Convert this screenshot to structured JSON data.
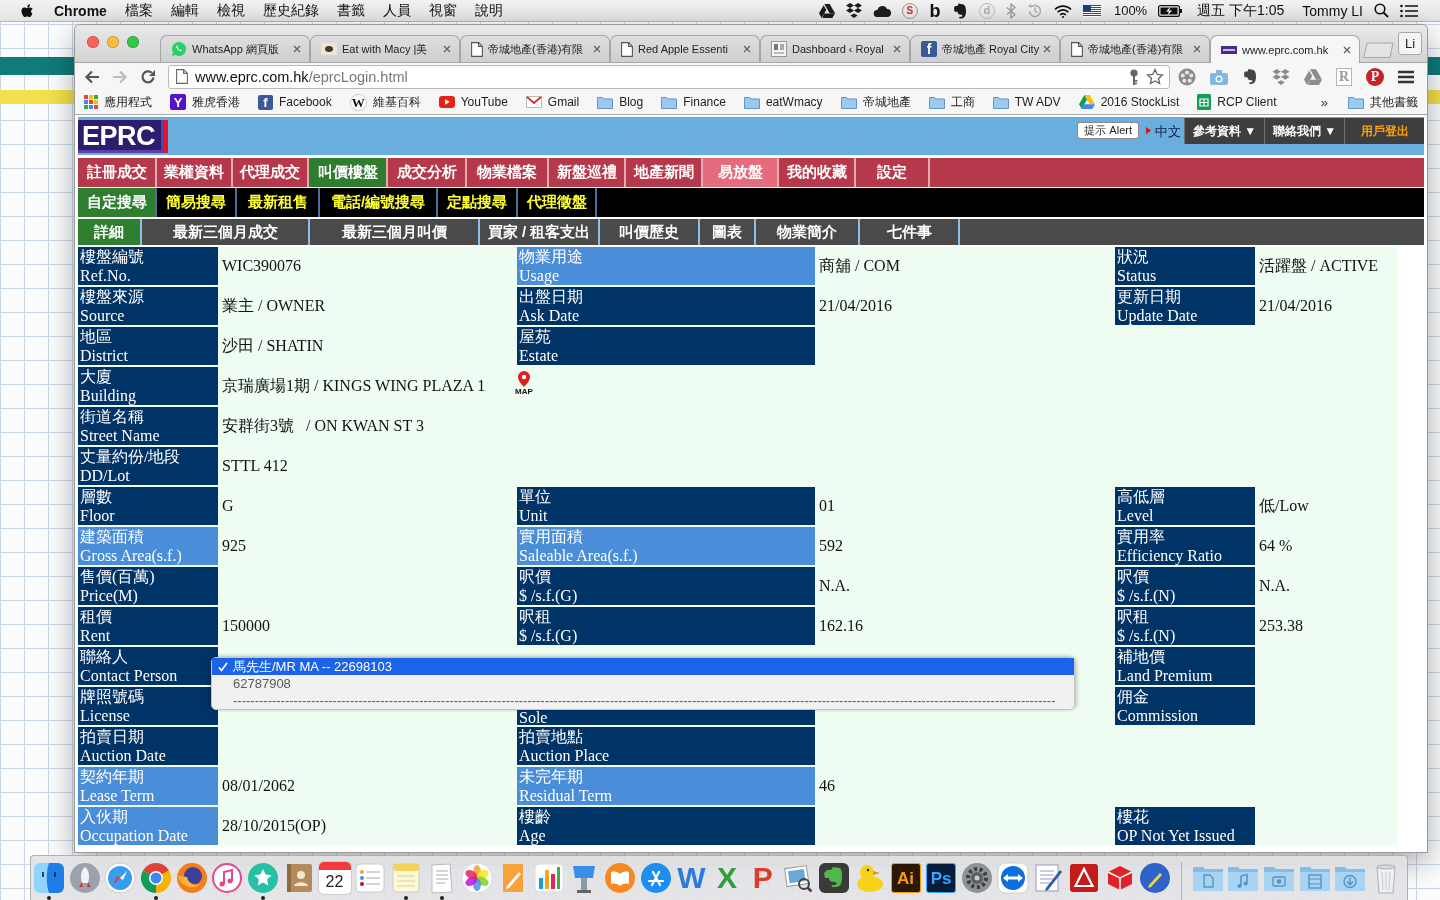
{
  "menubar": {
    "app_name": "Chrome",
    "menus": [
      "檔案",
      "編輯",
      "檢視",
      "歷史紀錄",
      "書籤",
      "人員",
      "視窗",
      "說明"
    ],
    "status_icons": [
      {
        "kind": "drive"
      },
      {
        "kind": "dropbox"
      },
      {
        "kind": "cloud"
      },
      {
        "kind": "seal",
        "glyph": "S"
      },
      {
        "kind": "letter",
        "glyph": "b"
      },
      {
        "kind": "evernote"
      },
      {
        "kind": "circled",
        "glyph": "d"
      },
      {
        "kind": "bluetooth"
      },
      {
        "kind": "time-machine"
      },
      {
        "kind": "wifi"
      },
      {
        "kind": "flag"
      }
    ],
    "battery": "100%",
    "clock": "週五 下午1:05",
    "user": "Tommy LI"
  },
  "browser": {
    "tabs": [
      {
        "kind": "whatsapp",
        "title": "WhatsApp 網頁版",
        "selected": false
      },
      {
        "kind": "thumbnail",
        "title": "Eat with Macy |美",
        "selected": false
      },
      {
        "kind": "document",
        "title": "帝城地產(香港)有限",
        "selected": false
      },
      {
        "kind": "document",
        "title": "Red Apple Essenti",
        "selected": false
      },
      {
        "kind": "rc",
        "title": "Dashboard ‹ Royal",
        "selected": false
      },
      {
        "kind": "facebook",
        "glyph": "f",
        "title": "帝城地產 Royal City",
        "selected": false
      },
      {
        "kind": "document",
        "title": "帝城地產(香港)有限",
        "selected": false
      },
      {
        "kind": "eprc",
        "title": "www.eprc.com.hk",
        "selected": true
      }
    ],
    "profile": "Li",
    "toolbar": {
      "nav_buttons": [
        {
          "kind": "back",
          "disabled": false
        },
        {
          "kind": "forward",
          "disabled": true
        },
        {
          "kind": "reload",
          "disabled": false
        }
      ],
      "url_domain": "www.eprc.com.hk",
      "url_path": "/eprcLogin.html",
      "extensions": [
        {
          "kind": "film"
        },
        {
          "kind": "camera"
        },
        {
          "kind": "evernote"
        },
        {
          "kind": "dropbox"
        },
        {
          "kind": "drive"
        },
        {
          "kind": "r-box",
          "glyph": "R"
        },
        {
          "kind": "pinterest",
          "glyph": "P"
        }
      ]
    },
    "bookmarks": {
      "items": [
        {
          "kind": "apps",
          "label": "應用程式"
        },
        {
          "kind": "yahoo",
          "glyph": "Y",
          "label": "雅虎香港"
        },
        {
          "kind": "facebook",
          "glyph": "f",
          "label": "Facebook"
        },
        {
          "kind": "wikipedia",
          "glyph": "W",
          "label": "維基百科"
        },
        {
          "kind": "youtube",
          "label": "YouTube"
        },
        {
          "kind": "gmail",
          "label": "Gmail"
        },
        {
          "kind": "folder",
          "label": "Blog"
        },
        {
          "kind": "folder",
          "label": "Finance"
        },
        {
          "kind": "folder",
          "label": "eatWmacy"
        },
        {
          "kind": "folder",
          "label": "帝城地產"
        },
        {
          "kind": "folder",
          "label": "工商"
        },
        {
          "kind": "folder",
          "label": "TW ADV"
        },
        {
          "kind": "drive",
          "label": "2016 StockList"
        },
        {
          "kind": "sheets",
          "label": "RCP Client"
        }
      ],
      "overflow": "»",
      "other": {
        "kind": "folder",
        "label": "其他書籤"
      }
    }
  },
  "page": {
    "header": {
      "logo": "EPRC",
      "alert_button": "提示 Alert",
      "language": "中文",
      "menu_buttons": [
        {
          "kind": "menu",
          "label": "參考資料 ▼"
        },
        {
          "kind": "menu",
          "label": "聯絡我們 ▼"
        },
        {
          "kind": "logout",
          "label": "用戶登出"
        }
      ]
    },
    "main_nav": [
      {
        "label": "註冊成交",
        "selected": false,
        "highlighted": false
      },
      {
        "label": "業權資料",
        "selected": false,
        "highlighted": false
      },
      {
        "label": "代理成交",
        "selected": false,
        "highlighted": false
      },
      {
        "label": "叫價樓盤",
        "selected": true,
        "highlighted": false
      },
      {
        "label": "成交分析",
        "selected": false,
        "highlighted": false
      },
      {
        "label": "物業檔案",
        "selected": false,
        "highlighted": false
      },
      {
        "label": "新盤巡禮",
        "selected": false,
        "highlighted": false
      },
      {
        "label": "地產新聞",
        "selected": false,
        "highlighted": false
      },
      {
        "label": "易放盤",
        "selected": false,
        "highlighted": true
      },
      {
        "label": "我的收藏",
        "selected": false,
        "highlighted": false
      },
      {
        "label": "設定",
        "selected": false,
        "highlighted": false
      }
    ],
    "search_nav": [
      {
        "label": "自定搜尋",
        "selected": true
      },
      {
        "label": "簡易搜尋",
        "selected": false
      },
      {
        "label": "最新租售",
        "selected": false
      },
      {
        "label": "電話/編號搜尋",
        "selected": false
      },
      {
        "label": "定點搜尋",
        "selected": false
      },
      {
        "label": "代理徵盤",
        "selected": false
      }
    ],
    "detail_tabs": [
      {
        "label": "詳細",
        "selected": true
      },
      {
        "label": "最新三個月成交",
        "selected": false
      },
      {
        "label": "最新三個月叫價",
        "selected": false
      },
      {
        "label": "買家 / 租客支出",
        "selected": false
      },
      {
        "label": "叫價歷史",
        "selected": false
      },
      {
        "label": "圖表",
        "selected": false
      },
      {
        "label": "物業簡介",
        "selected": false
      },
      {
        "label": "七件事",
        "selected": false
      }
    ],
    "table": {
      "rows": [
        {
          "cells": [
            {
              "kind": "label",
              "zh": "樓盤編號",
              "en": "Ref.No.",
              "highlighted": false
            },
            {
              "kind": "value",
              "text": "WIC390076"
            },
            {
              "kind": "label",
              "zh": "物業用途",
              "en": "Usage",
              "highlighted": true
            },
            {
              "kind": "value",
              "text": "商舖 / COM"
            },
            {
              "kind": "label",
              "zh": "狀況",
              "en": "Status",
              "highlighted": false
            },
            {
              "kind": "value",
              "text": "活躍盤 / ACTIVE"
            }
          ]
        },
        {
          "cells": [
            {
              "kind": "label",
              "zh": "樓盤來源",
              "en": "Source",
              "highlighted": false
            },
            {
              "kind": "value",
              "text": "業主 / OWNER"
            },
            {
              "kind": "label",
              "zh": "出盤日期",
              "en": "Ask Date",
              "highlighted": false
            },
            {
              "kind": "value",
              "text": "21/04/2016"
            },
            {
              "kind": "label",
              "zh": "更新日期",
              "en": "Update Date",
              "highlighted": false
            },
            {
              "kind": "value",
              "text": "21/04/2016"
            }
          ]
        },
        {
          "cells": [
            {
              "kind": "label",
              "zh": "地區",
              "en": "District",
              "highlighted": false
            },
            {
              "kind": "value",
              "text": "沙田 / SHATIN"
            },
            {
              "kind": "label",
              "zh": "屋苑",
              "en": "Estate",
              "highlighted": false
            }
          ]
        },
        {
          "cells": [
            {
              "kind": "label",
              "zh": "大廈",
              "en": "Building",
              "highlighted": false
            },
            {
              "kind": "value",
              "text": "京瑞廣場1期 / KINGS WING PLAZA 1"
            },
            {
              "kind": "map",
              "label": "MAP"
            }
          ]
        },
        {
          "cells": [
            {
              "kind": "label",
              "zh": "街道名稱",
              "en": "Street Name",
              "highlighted": false
            },
            {
              "kind": "value",
              "text": "安群街3號   / ON KWAN ST 3"
            }
          ]
        },
        {
          "cells": [
            {
              "kind": "label",
              "zh": "丈量約份/地段",
              "en": "DD/Lot",
              "highlighted": false
            },
            {
              "kind": "value",
              "text": "STTL 412"
            }
          ]
        },
        {
          "cells": [
            {
              "kind": "label",
              "zh": "層數",
              "en": "Floor",
              "highlighted": false
            },
            {
              "kind": "value",
              "text": "G"
            },
            {
              "kind": "label",
              "zh": "單位",
              "en": "Unit",
              "highlighted": false
            },
            {
              "kind": "value",
              "text": "01"
            },
            {
              "kind": "label",
              "zh": "高低層",
              "en": "Level",
              "highlighted": false
            },
            {
              "kind": "value",
              "text": "低/Low"
            }
          ]
        },
        {
          "cells": [
            {
              "kind": "label",
              "zh": "建築面積",
              "en": "Gross Area(s.f.)",
              "highlighted": true
            },
            {
              "kind": "value",
              "text": "925"
            },
            {
              "kind": "label",
              "zh": "實用面積",
              "en": "Saleable Area(s.f.)",
              "highlighted": true
            },
            {
              "kind": "value",
              "text": "592"
            },
            {
              "kind": "label",
              "zh": "實用率",
              "en": "Efficiency Ratio",
              "highlighted": false
            },
            {
              "kind": "value",
              "text": "64 %"
            }
          ]
        },
        {
          "cells": [
            {
              "kind": "label",
              "zh": "售價(百萬)",
              "en": "Price(M)",
              "highlighted": false
            },
            {
              "kind": "value"
            },
            {
              "kind": "label",
              "zh": "呎價",
              "en": "$ /s.f.(G)",
              "highlighted": false
            },
            {
              "kind": "value",
              "text": "N.A."
            },
            {
              "kind": "label",
              "zh": "呎價",
              "en": "$ /s.f.(N)",
              "highlighted": false
            },
            {
              "kind": "value",
              "text": "N.A."
            }
          ]
        },
        {
          "cells": [
            {
              "kind": "label",
              "zh": "租價",
              "en": "Rent",
              "highlighted": false
            },
            {
              "kind": "value",
              "text": "150000"
            },
            {
              "kind": "label",
              "zh": "呎租",
              "en": "$ /s.f.(G)",
              "highlighted": false
            },
            {
              "kind": "value",
              "text": "162.16"
            },
            {
              "kind": "label",
              "zh": "呎租",
              "en": "$ /s.f.(N)",
              "highlighted": false
            },
            {
              "kind": "value",
              "text": "253.38"
            }
          ]
        },
        {
          "cells": [
            {
              "kind": "label",
              "zh": "聯絡人",
              "en": "Contact Person",
              "highlighted": false
            },
            {
              "kind": "value"
            },
            {
              "kind": "value"
            },
            {
              "kind": "value"
            },
            {
              "kind": "label",
              "zh": "補地價",
              "en": "Land Premium",
              "highlighted": false
            }
          ]
        },
        {
          "cells": [
            {
              "kind": "label",
              "zh": "牌照號碼",
              "en": "License",
              "highlighted": false
            },
            {
              "kind": "value"
            },
            {
              "kind": "label",
              "en": "Sole",
              "highlighted": false
            },
            {
              "kind": "value"
            },
            {
              "kind": "label",
              "zh": "佣金",
              "en": "Commission",
              "highlighted": false
            }
          ]
        },
        {
          "cells": [
            {
              "kind": "label",
              "zh": "拍賣日期",
              "en": "Auction Date",
              "highlighted": false
            },
            {
              "kind": "value"
            },
            {
              "kind": "label",
              "zh": "拍賣地點",
              "en": "Auction Place",
              "highlighted": false
            }
          ]
        },
        {
          "cells": [
            {
              "kind": "label",
              "zh": "契約年期",
              "en": "Lease Term",
              "highlighted": true
            },
            {
              "kind": "value",
              "text": "08/01/2062"
            },
            {
              "kind": "label",
              "zh": "未完年期",
              "en": "Residual Term",
              "highlighted": true
            },
            {
              "kind": "value",
              "text": "46"
            }
          ]
        },
        {
          "cells": [
            {
              "kind": "label",
              "zh": "入伙期",
              "en": "Occupation Date",
              "highlighted": true
            },
            {
              "kind": "value",
              "text": "28/10/2015(OP)"
            },
            {
              "kind": "label",
              "zh": "樓齡",
              "en": "Age",
              "highlighted": false
            },
            {
              "kind": "value"
            },
            {
              "kind": "label",
              "zh": "樓花",
              "en": "OP Not Yet Issued",
              "highlighted": false
            }
          ]
        }
      ]
    },
    "contact_dropdown": {
      "options": [
        {
          "text": "馬先生/MR MA -- 22698103",
          "selected": true,
          "disabled": false
        },
        {
          "text": "62787908",
          "selected": false,
          "disabled": true
        },
        {
          "text": "----------------------------------------------------------------------------------------------------------------------------------------------------------------------------------------------",
          "selected": false,
          "disabled": true
        }
      ]
    }
  },
  "dock": {
    "apps": [
      {
        "kind": "finder",
        "running": true
      },
      {
        "kind": "launchpad",
        "running": false
      },
      {
        "kind": "safari",
        "running": false
      },
      {
        "kind": "chrome",
        "running": true
      },
      {
        "kind": "firefox",
        "running": false
      },
      {
        "kind": "itunes",
        "running": false
      },
      {
        "kind": "star",
        "running": true
      },
      {
        "kind": "contacts",
        "running": false
      },
      {
        "kind": "calendar",
        "glyph": "22",
        "running": false
      },
      {
        "kind": "reminders",
        "running": false
      },
      {
        "kind": "notes",
        "running": true
      },
      {
        "kind": "textedit",
        "running": true
      },
      {
        "kind": "photos",
        "running": false
      },
      {
        "kind": "pages",
        "running": false
      },
      {
        "kind": "numbers",
        "running": false
      },
      {
        "kind": "keynote",
        "running": false
      },
      {
        "kind": "ibooks",
        "running": false
      },
      {
        "kind": "app-store",
        "running": false
      },
      {
        "kind": "letter-w",
        "glyph": "W",
        "running": false
      },
      {
        "kind": "letter-x",
        "glyph": "X",
        "running": false
      },
      {
        "kind": "letter-p",
        "glyph": "P",
        "running": false
      },
      {
        "kind": "preview",
        "running": false
      },
      {
        "kind": "evernote",
        "running": false
      },
      {
        "kind": "duck",
        "running": false
      },
      {
        "kind": "illustrator",
        "glyph": "Ai",
        "running": false
      },
      {
        "kind": "photoshop",
        "glyph": "Ps",
        "running": false
      },
      {
        "kind": "system-prefs",
        "running": false
      },
      {
        "kind": "teamviewer",
        "running": false
      },
      {
        "kind": "notebook",
        "running": false
      },
      {
        "kind": "acrobat",
        "running": false
      },
      {
        "kind": "sketchup",
        "running": false
      },
      {
        "kind": "pen",
        "running": false
      }
    ],
    "stacks": [
      {
        "kind": "documents"
      },
      {
        "kind": "music"
      },
      {
        "kind": "pictures"
      },
      {
        "kind": "movies"
      },
      {
        "kind": "downloads"
      },
      {
        "kind": "trash"
      }
    ]
  }
}
